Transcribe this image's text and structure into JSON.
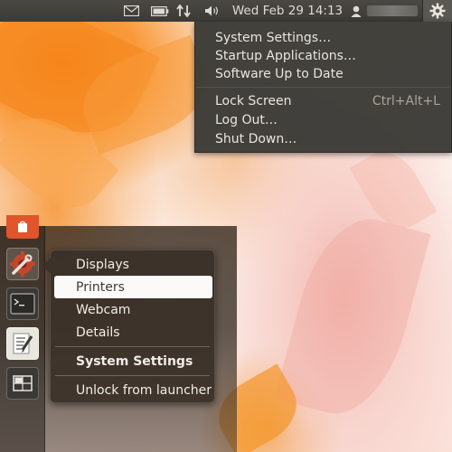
{
  "panel": {
    "mail_icon": "envelope-icon",
    "battery_icon": "battery-icon",
    "network_icon": "network-transfer-icon",
    "volume_icon": "speaker-icon",
    "clock": "Wed Feb 29 14:13",
    "user_icon": "user-icon",
    "session_icon": "gear-icon"
  },
  "session_menu": {
    "items": [
      {
        "label": "System Settings…"
      },
      {
        "label": "Startup Applications…"
      },
      {
        "label": "Software Up to Date"
      },
      {
        "label": "Lock Screen",
        "accel": "Ctrl+Alt+L"
      },
      {
        "label": "Log Out…"
      },
      {
        "label": "Shut Down…"
      }
    ]
  },
  "launcher": {
    "items": [
      {
        "name": "ubuntu-software-center",
        "icon": "shopping-bag-icon"
      },
      {
        "name": "system-settings",
        "icon": "settings-tools-icon"
      },
      {
        "name": "terminal",
        "icon": "terminal-icon"
      },
      {
        "name": "text-editor",
        "icon": "text-editor-icon"
      },
      {
        "name": "workspace-switcher",
        "icon": "workspace-switcher-icon"
      }
    ]
  },
  "quicklist": {
    "items": [
      "Displays",
      "Printers",
      "Webcam",
      "Details"
    ],
    "highlighted": "Printers",
    "title": "System Settings",
    "unlock": "Unlock from launcher"
  },
  "colors": {
    "panel": "#3c3b37",
    "menu_bg": "#3c3b37",
    "quicklist_bg": "#3a3028",
    "wallpaper_orange": "#f58a1e",
    "wallpaper_pink": "#f2b4ad"
  }
}
